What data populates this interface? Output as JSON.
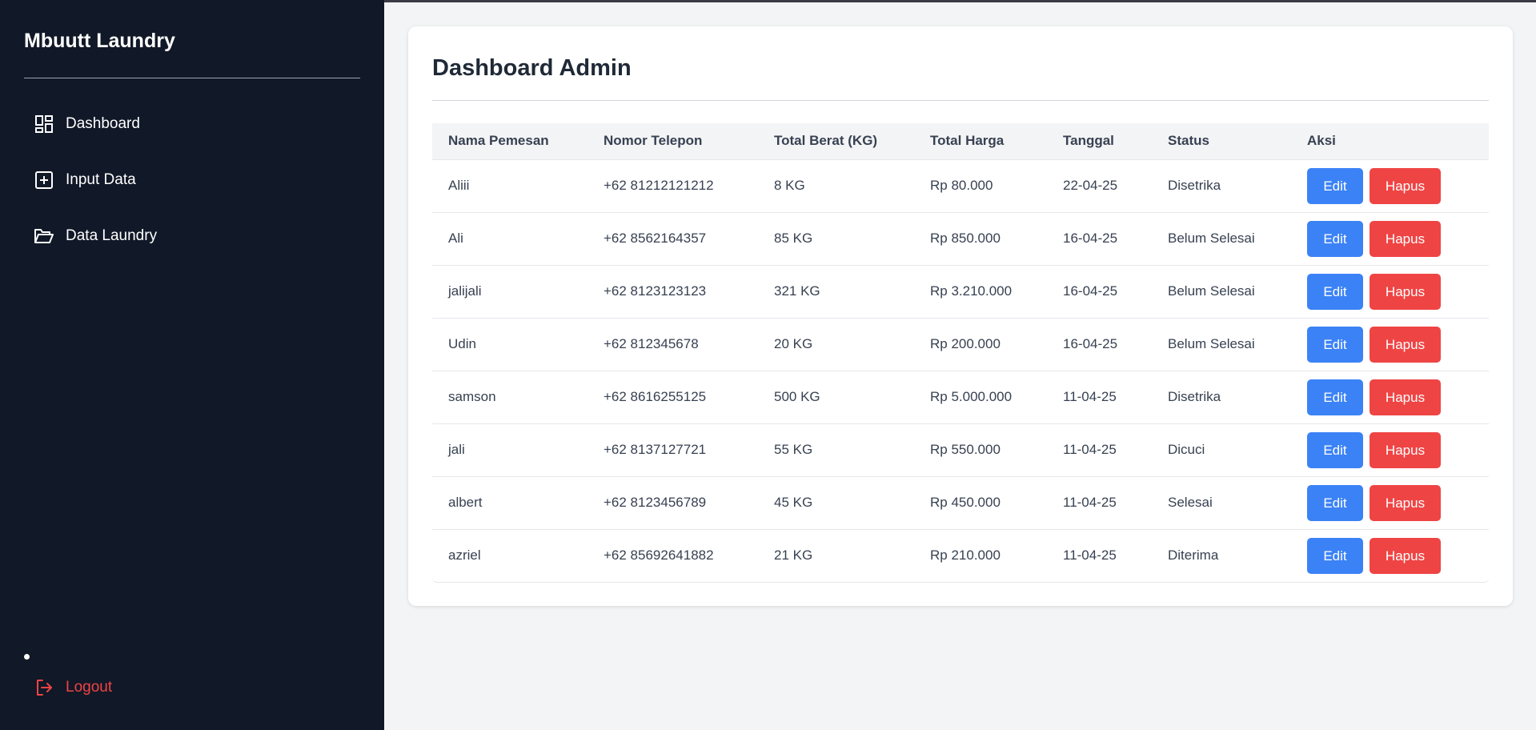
{
  "sidebar": {
    "brand": "Mbuutt Laundry",
    "items": [
      {
        "label": "Dashboard",
        "icon": "dashboard-icon"
      },
      {
        "label": "Input Data",
        "icon": "plus-square-icon"
      },
      {
        "label": "Data Laundry",
        "icon": "folder-open-icon"
      }
    ],
    "logout_label": "Logout",
    "logout_icon": "logout-icon"
  },
  "main": {
    "title": "Dashboard Admin",
    "table": {
      "columns": [
        "Nama Pemesan",
        "Nomor Telepon",
        "Total Berat (KG)",
        "Total Harga",
        "Tanggal",
        "Status",
        "Aksi"
      ],
      "edit_label": "Edit",
      "delete_label": "Hapus",
      "rows": [
        {
          "nama": "Aliii",
          "telepon": "+62 81212121212",
          "berat": "8 KG",
          "harga": "Rp 80.000",
          "tanggal": "22-04-25",
          "status": "Disetrika"
        },
        {
          "nama": "Ali",
          "telepon": "+62 8562164357",
          "berat": "85 KG",
          "harga": "Rp 850.000",
          "tanggal": "16-04-25",
          "status": "Belum Selesai"
        },
        {
          "nama": "jalijali",
          "telepon": "+62 8123123123",
          "berat": "321 KG",
          "harga": "Rp 3.210.000",
          "tanggal": "16-04-25",
          "status": "Belum Selesai"
        },
        {
          "nama": "Udin",
          "telepon": "+62 812345678",
          "berat": "20 KG",
          "harga": "Rp 200.000",
          "tanggal": "16-04-25",
          "status": "Belum Selesai"
        },
        {
          "nama": "samson",
          "telepon": "+62 8616255125",
          "berat": "500 KG",
          "harga": "Rp 5.000.000",
          "tanggal": "11-04-25",
          "status": "Disetrika"
        },
        {
          "nama": "jali",
          "telepon": "+62 8137127721",
          "berat": "55 KG",
          "harga": "Rp 550.000",
          "tanggal": "11-04-25",
          "status": "Dicuci"
        },
        {
          "nama": "albert",
          "telepon": "+62 8123456789",
          "berat": "45 KG",
          "harga": "Rp 450.000",
          "tanggal": "11-04-25",
          "status": "Selesai"
        },
        {
          "nama": "azriel",
          "telepon": "+62 85692641882",
          "berat": "21 KG",
          "harga": "Rp 210.000",
          "tanggal": "11-04-25",
          "status": "Diterima"
        }
      ]
    }
  },
  "colors": {
    "sidebar_bg": "#111827",
    "page_bg": "#f3f4f6",
    "edit_button": "#3b82f6",
    "delete_button": "#ef4444",
    "logout_text": "#ef4444"
  }
}
